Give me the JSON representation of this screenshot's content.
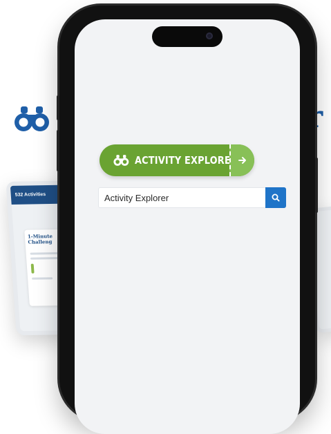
{
  "background": {
    "title_fragment": "r",
    "tablet": {
      "header": "532 Activities",
      "card_title": "1-Minute Challeng"
    }
  },
  "explorer_banner": {
    "label": "ACTIVITY EXPLORER",
    "icon": "binoculars-icon",
    "go_icon": "arrow-right-icon"
  },
  "search": {
    "value": "Activity Explorer",
    "button_icon": "search-icon"
  },
  "colors": {
    "banner_green": "#6aa332",
    "banner_go_green": "#88c057",
    "search_blue": "#1f74c8",
    "brand_blue": "#1f5fa8"
  }
}
